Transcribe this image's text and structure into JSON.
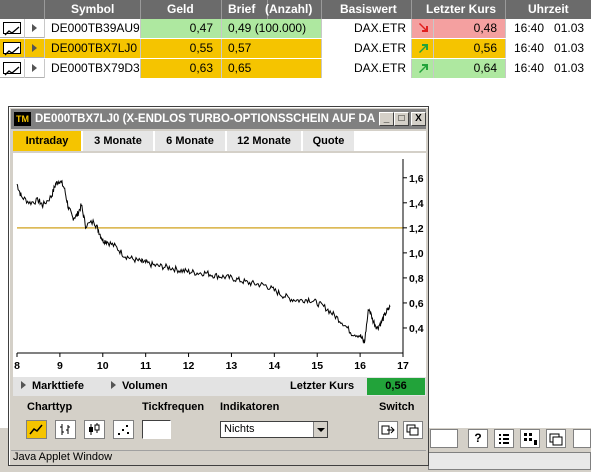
{
  "table": {
    "headers": {
      "symbol": "Symbol",
      "geld": "Geld",
      "brief": "Brief",
      "anzahl": "(Anzahl)",
      "basiswert": "Basiswert",
      "letzter_kurs": "Letzter Kurs",
      "uhrzeit": "Uhrzeit"
    },
    "rows": [
      {
        "symbol": "DE000TB39AU9",
        "geld": "0,47",
        "brief": "0,49 (100.000)",
        "basiswert": "DAX.ETR",
        "trend": "down",
        "letzter_kurs": "0,48",
        "uhrzeit": "16:40   01.03",
        "row_color": "#ffffff",
        "geld_color": "#aee8a0",
        "brief_color": "#aee8a0",
        "kurs_color": "#f4a0a0"
      },
      {
        "symbol": "DE000TBX7LJ0",
        "geld": "0,55",
        "brief": "0,57",
        "basiswert": "DAX.ETR",
        "trend": "up",
        "letzter_kurs": "0,56",
        "uhrzeit": "16:40   01.03",
        "row_color": "#f5c400",
        "geld_color": "#f5c400",
        "brief_color": "#f5c400",
        "kurs_color": "#f5c400"
      },
      {
        "symbol": "DE000TBX79D3",
        "geld": "0,63",
        "brief": "0,65",
        "basiswert": "DAX.ETR",
        "trend": "up",
        "letzter_kurs": "0,64",
        "uhrzeit": "16:40   01.03",
        "row_color": "#ffffff",
        "geld_color": "#f5c400",
        "brief_color": "#f5c400",
        "kurs_color": "#aee8a0"
      }
    ]
  },
  "applet": {
    "title": "DE000TBX7LJ0 (X-ENDLOS TURBO-OPTIONSSCHEIN AUF DA...",
    "logo_text": "TM",
    "window_buttons": {
      "minimize": "_",
      "maximize": "□",
      "close": "X"
    },
    "tabs": [
      "Intraday",
      "3 Monate",
      "6 Monate",
      "12 Monate",
      "Quote"
    ],
    "active_tab": 0,
    "info": {
      "markttiefe": "Markttiefe",
      "volumen": "Volumen",
      "letzter_kurs_label": "Letzter Kurs",
      "letzter_kurs_value": "0,56"
    },
    "controls": {
      "charttyp": "Charttyp",
      "tickfrequenz": "Tickfrequen",
      "indikatoren": "Indikatoren",
      "switch": "Switch",
      "indikator_selected": "Nichts"
    },
    "status": "Java Applet Window"
  },
  "colors": {
    "accent": "#f5c400",
    "up": "#22a33a",
    "down": "#e02020",
    "header_bg": "#6b6b6b",
    "reference_line": "#d8b040"
  },
  "chart_data": {
    "type": "line",
    "title": "",
    "xlabel": "",
    "ylabel": "",
    "xlim": [
      8,
      17
    ],
    "ylim": [
      0.2,
      1.75
    ],
    "x_ticks": [
      "8",
      "9",
      "10",
      "11",
      "12",
      "13",
      "14",
      "15",
      "16",
      "17"
    ],
    "y_ticks": [
      "1,6",
      "1,4",
      "1,2",
      "1,0",
      "0,8",
      "0,6",
      "0,4"
    ],
    "reference_line": 1.2,
    "series": [
      {
        "color": "#000000",
        "x": [
          8.0,
          8.1,
          8.3,
          8.5,
          8.6,
          8.8,
          8.9,
          9.0,
          9.1,
          9.2,
          9.3,
          9.4,
          9.5,
          9.6,
          9.8,
          9.9,
          10.0,
          10.1,
          10.3,
          10.5,
          10.7,
          10.9,
          11.0,
          11.2,
          11.4,
          11.6,
          11.8,
          12.0,
          12.2,
          12.4,
          12.6,
          12.8,
          13.0,
          13.2,
          13.4,
          13.6,
          13.8,
          14.0,
          14.2,
          14.4,
          14.6,
          14.8,
          15.0,
          15.2,
          15.4,
          15.6,
          15.8,
          16.0,
          16.1,
          16.2,
          16.3,
          16.4,
          16.5,
          16.6,
          16.7
        ],
        "values": [
          1.55,
          1.45,
          1.4,
          1.42,
          1.38,
          1.45,
          1.55,
          1.58,
          1.52,
          1.36,
          1.28,
          1.3,
          1.38,
          1.22,
          1.25,
          1.18,
          1.1,
          1.09,
          1.05,
          0.98,
          0.95,
          0.93,
          0.92,
          0.9,
          0.89,
          0.88,
          0.86,
          0.85,
          0.84,
          0.84,
          0.82,
          0.81,
          0.8,
          0.78,
          0.76,
          0.75,
          0.74,
          0.7,
          0.66,
          0.63,
          0.62,
          0.63,
          0.6,
          0.56,
          0.5,
          0.44,
          0.36,
          0.34,
          0.28,
          0.56,
          0.46,
          0.4,
          0.45,
          0.52,
          0.57
        ]
      }
    ]
  },
  "toolbar": {
    "search_value": ""
  }
}
